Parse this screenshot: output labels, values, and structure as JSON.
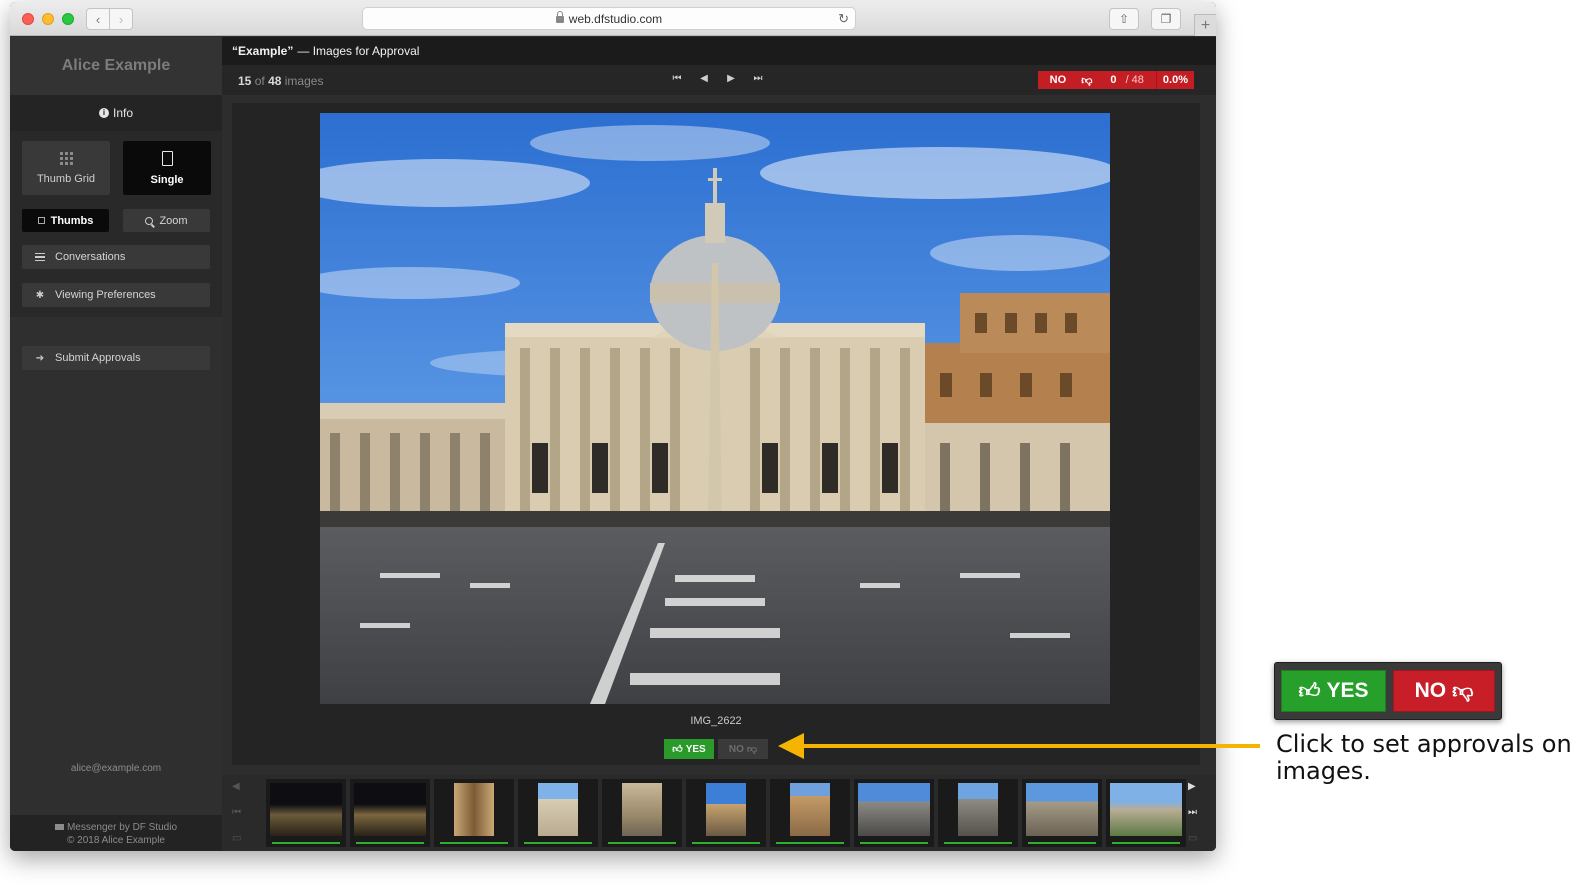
{
  "browser": {
    "url": "web.dfstudio.com",
    "back_icon": "chevron-left-icon",
    "forward_icon": "chevron-right-icon"
  },
  "sidebar": {
    "account_name": "Alice Example",
    "info_label": "Info",
    "view_modes": [
      {
        "label": "Thumb Grid",
        "icon": "grid-icon",
        "selected": false
      },
      {
        "label": "Single",
        "icon": "single-page-icon",
        "selected": true
      }
    ],
    "thumbs_label": "Thumbs",
    "zoom_label": "Zoom",
    "conversations_label": "Conversations",
    "viewing_preferences_label": "Viewing Preferences",
    "submit_approvals_label": "Submit Approvals",
    "email": "alice@example.com",
    "footer_line1": "Messenger",
    "footer_by": "by",
    "footer_brand": "DF Studio",
    "footer_line2": "© 2018 Alice Example"
  },
  "header": {
    "title_bold": "“Example”",
    "title_rest": "— Images for Approval",
    "current_index": "15",
    "of": "of",
    "total": "48",
    "unit": "images",
    "tally_no": "NO",
    "tally_count": "0",
    "tally_total": "/ 48",
    "tally_percent": "0.0%"
  },
  "viewer": {
    "image_name": "IMG_2622",
    "yes_label": "YES",
    "no_label": "NO"
  },
  "filmstrip": {
    "thumb_count": 11,
    "approved_indicator_color": "#2fae2f"
  },
  "callout": {
    "yes_label": "YES",
    "no_label": "NO",
    "text": "Click to set approvals on images.",
    "arrow_color": "#f5b400"
  },
  "colors": {
    "yes_green": "#2a9a2a",
    "no_red": "#c41e25",
    "sidebar_bg": "#2f2f2f"
  }
}
